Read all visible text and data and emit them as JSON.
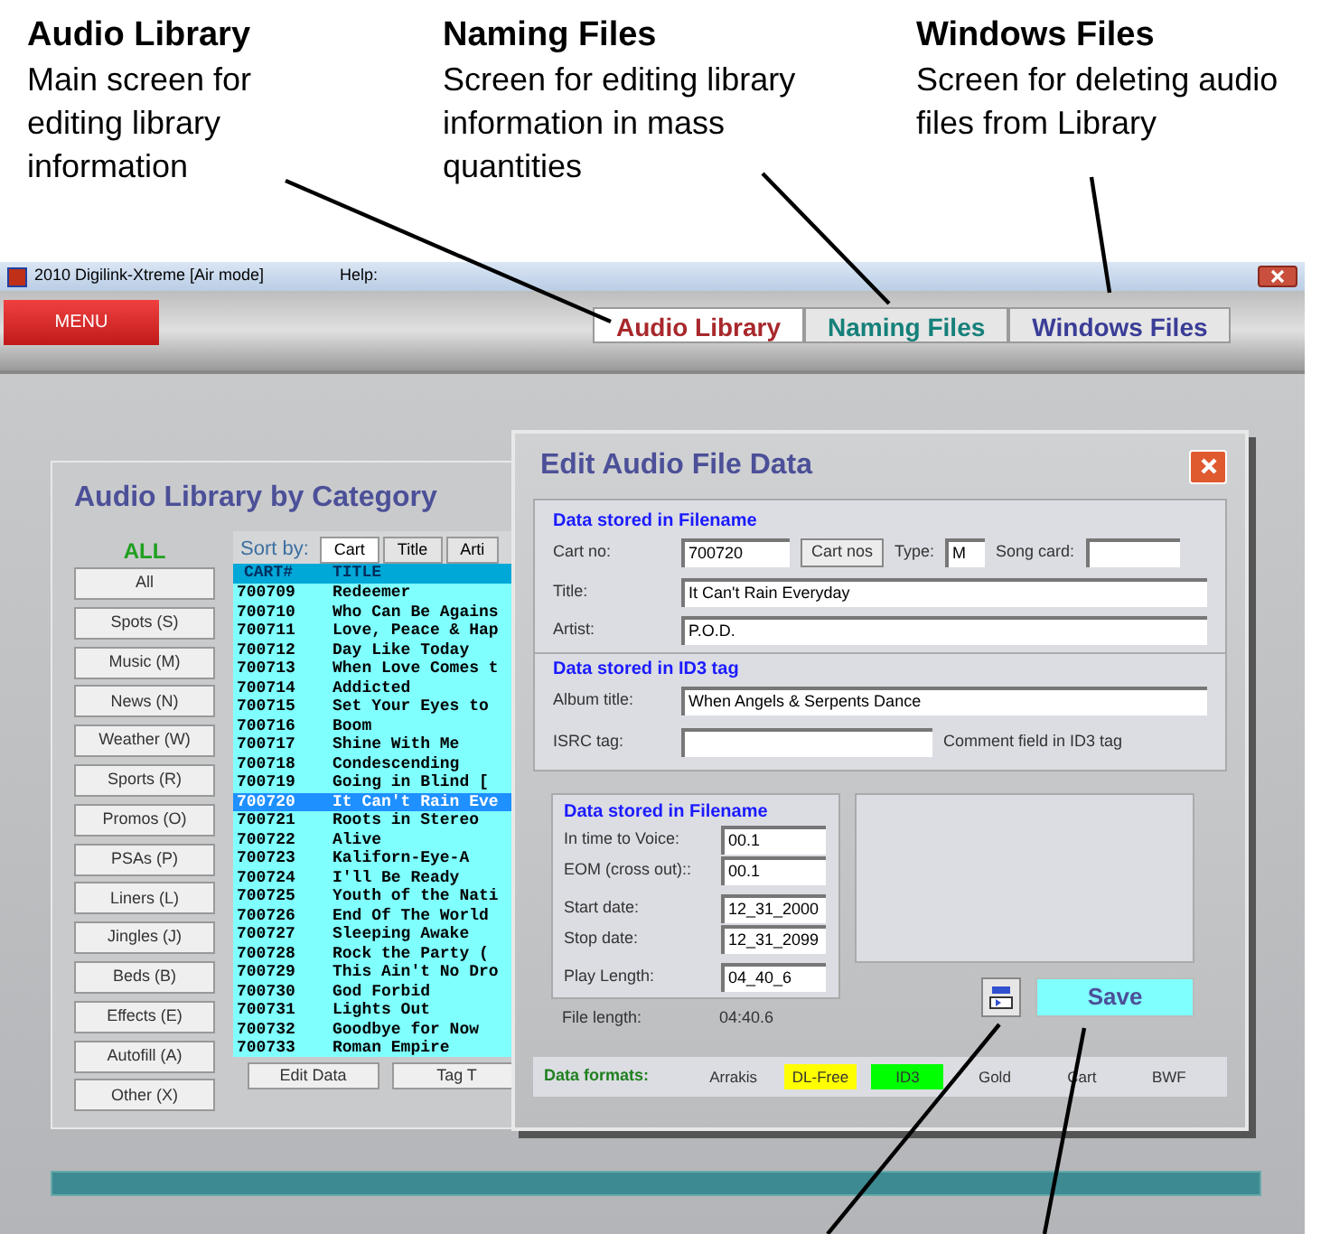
{
  "callouts": [
    {
      "title": "Audio Library",
      "text": "Main screen for editing library information"
    },
    {
      "title": "Naming Files",
      "text": "Screen for editing library information in mass quantities"
    },
    {
      "title": "Windows Files",
      "text": "Screen for deleting audio files from Library"
    }
  ],
  "window": {
    "title": "2010 Digilink-Xtreme [Air mode]",
    "menu": [
      "Help:"
    ],
    "menu_button": "MENU",
    "tabs": [
      {
        "label": "Audio Library",
        "selected": true,
        "color": "#a8282c"
      },
      {
        "label": "Naming Files",
        "selected": false,
        "color": "#16807a"
      },
      {
        "label": "Windows Files",
        "selected": false,
        "color": "#3a3d96"
      }
    ]
  },
  "library": {
    "title": "Audio Library by Category",
    "category_label": "ALL",
    "categories": [
      "All",
      "Spots (S)",
      "Music (M)",
      "News (N)",
      "Weather (W)",
      "Sports (R)",
      "Promos (O)",
      "PSAs (P)",
      "Liners (L)",
      "Jingles (J)",
      "Beds (B)",
      "Effects (E)",
      "Autofill (A)",
      "Other (X)"
    ],
    "sort_label": "Sort by:",
    "sort_tabs": [
      {
        "label": "Cart",
        "selected": true
      },
      {
        "label": "Title",
        "selected": false
      },
      {
        "label": "Arti",
        "selected": false
      }
    ],
    "columns": [
      "CART#",
      "TITLE"
    ],
    "rows": [
      {
        "cart": "700709",
        "title": "Redeemer",
        "selected": false
      },
      {
        "cart": "700710",
        "title": "Who Can Be Agains",
        "selected": false
      },
      {
        "cart": "700711",
        "title": "Love, Peace & Hap",
        "selected": false
      },
      {
        "cart": "700712",
        "title": "Day Like Today",
        "selected": false
      },
      {
        "cart": "700713",
        "title": "When Love Comes t",
        "selected": false
      },
      {
        "cart": "700714",
        "title": "Addicted",
        "selected": false
      },
      {
        "cart": "700715",
        "title": "Set Your Eyes to",
        "selected": false
      },
      {
        "cart": "700716",
        "title": "Boom",
        "selected": false
      },
      {
        "cart": "700717",
        "title": "Shine With Me",
        "selected": false
      },
      {
        "cart": "700718",
        "title": "Condescending",
        "selected": false
      },
      {
        "cart": "700719",
        "title": "Going in Blind [",
        "selected": false
      },
      {
        "cart": "700720",
        "title": "It Can't Rain Eve",
        "selected": true
      },
      {
        "cart": "700721",
        "title": "Roots in Stereo",
        "selected": false
      },
      {
        "cart": "700722",
        "title": "Alive",
        "selected": false
      },
      {
        "cart": "700723",
        "title": "Kaliforn-Eye-A",
        "selected": false
      },
      {
        "cart": "700724",
        "title": "I'll Be Ready",
        "selected": false
      },
      {
        "cart": "700725",
        "title": "Youth of the Nati",
        "selected": false
      },
      {
        "cart": "700726",
        "title": "End Of The World",
        "selected": false
      },
      {
        "cart": "700727",
        "title": "Sleeping Awake",
        "selected": false
      },
      {
        "cart": "700728",
        "title": "Rock the Party (",
        "selected": false
      },
      {
        "cart": "700729",
        "title": "This Ain't No Dro",
        "selected": false
      },
      {
        "cart": "700730",
        "title": "God Forbid",
        "selected": false
      },
      {
        "cart": "700731",
        "title": "Lights Out",
        "selected": false
      },
      {
        "cart": "700732",
        "title": "Goodbye for Now",
        "selected": false
      },
      {
        "cart": "700733",
        "title": "Roman Empire",
        "selected": false
      }
    ],
    "buttons": [
      "Edit Data",
      "Tag T"
    ]
  },
  "dialog": {
    "title": "Edit Audio File Data",
    "filename_heading": "Data stored in Filename",
    "cart_label": "Cart no:",
    "cart_value": "700720",
    "cart_button": "Cart nos",
    "type_label": "Type:",
    "type_value": "M",
    "song_card_label": "Song card:",
    "title_label": "Title:",
    "title_value": "It Can't Rain Everyday",
    "artist_label": "Artist:",
    "artist_value": "P.O.D.",
    "id3_heading": "Data stored in ID3 tag",
    "album_label": "Album title:",
    "album_value": "When Angels & Serpents Dance",
    "isrc_label": "ISRC tag:",
    "isrc_note": "Comment field in ID3 tag",
    "timing_heading": "Data stored in Filename",
    "timing_fields": [
      {
        "label": "In time to Voice:",
        "value": "00.1"
      },
      {
        "label": "EOM (cross out)::",
        "value": "00.1"
      },
      {
        "label": "Start date:",
        "value": "12_31_2000"
      },
      {
        "label": "Stop date:",
        "value": "12_31_2099"
      },
      {
        "label": "Play Length:",
        "value": "04_40_6"
      }
    ],
    "file_length_label": "File length:",
    "file_length_value": "04:40.6",
    "save_button": "Save",
    "formats_label": "Data formats:",
    "formats": [
      {
        "label": "Arrakis"
      },
      {
        "label": "DL-Free",
        "color": "#ffff00"
      },
      {
        "label": "ID3",
        "color": "#00ff00"
      },
      {
        "label": "Gold"
      },
      {
        "label": "Cart"
      },
      {
        "label": "BWF"
      }
    ]
  }
}
